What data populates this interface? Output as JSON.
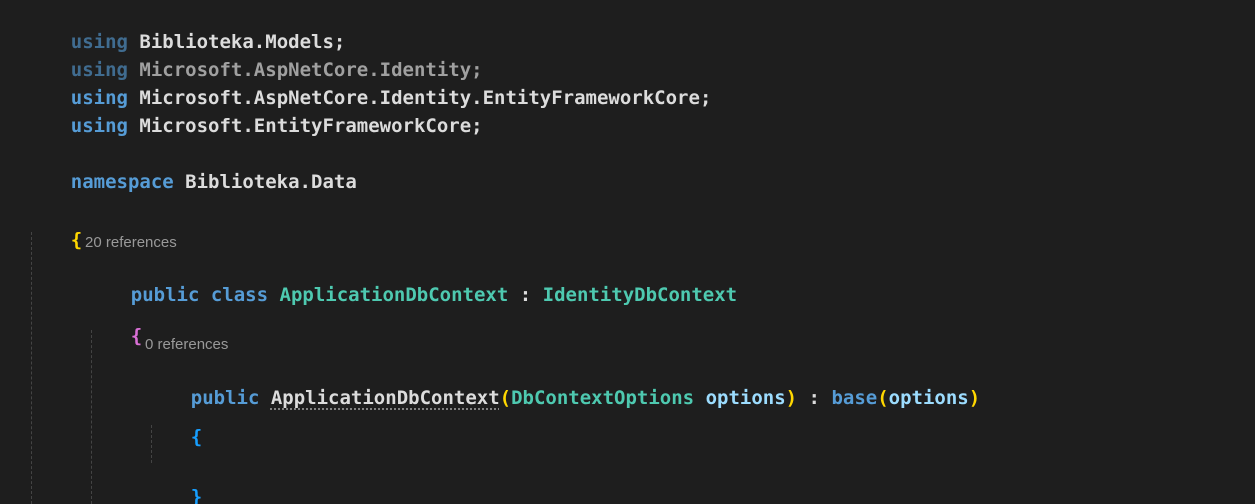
{
  "colors": {
    "background": "#1e1e1e",
    "keyword": "#569cd6",
    "type": "#4ec9b0",
    "parameter": "#9cdcfe",
    "plain": "#dcdcdc",
    "brace_level1": "#ffd700",
    "brace_level2": "#da70d6",
    "brace_level3": "#179fff",
    "codelens": "#999999",
    "indent_guide": "#444444"
  },
  "code": {
    "l1": {
      "kw": "using",
      "ns": "Biblioteka.Models",
      "end": ";"
    },
    "l2": {
      "kw": "using",
      "ns": "Microsoft.AspNetCore.Identity",
      "end": ";"
    },
    "l3": {
      "kw": "using",
      "ns": "Microsoft.AspNetCore.Identity.EntityFrameworkCore",
      "end": ";"
    },
    "l4": {
      "kw": "using",
      "ns": "Microsoft.EntityFrameworkCore",
      "end": ";"
    },
    "l6": {
      "kw": "namespace",
      "ns": "Biblioteka.Data"
    },
    "l7": {
      "brace": "{"
    },
    "lens_class": "20 references",
    "l8": {
      "kw1": "public",
      "kw2": "class",
      "name": "ApplicationDbContext",
      "colon": " : ",
      "base": "IdentityDbContext"
    },
    "l9": {
      "brace": "{"
    },
    "lens_ctor": "0 references",
    "l10": {
      "kw": "public",
      "name": "ApplicationDbContext",
      "open": "(",
      "ptype": "DbContextOptions",
      "pname": "options",
      "close": ")",
      "colon": " : ",
      "base_kw": "base",
      "open2": "(",
      "arg": "options",
      "close2": ")"
    },
    "l11": {
      "brace": "{"
    },
    "l13": {
      "brace": "}"
    }
  }
}
